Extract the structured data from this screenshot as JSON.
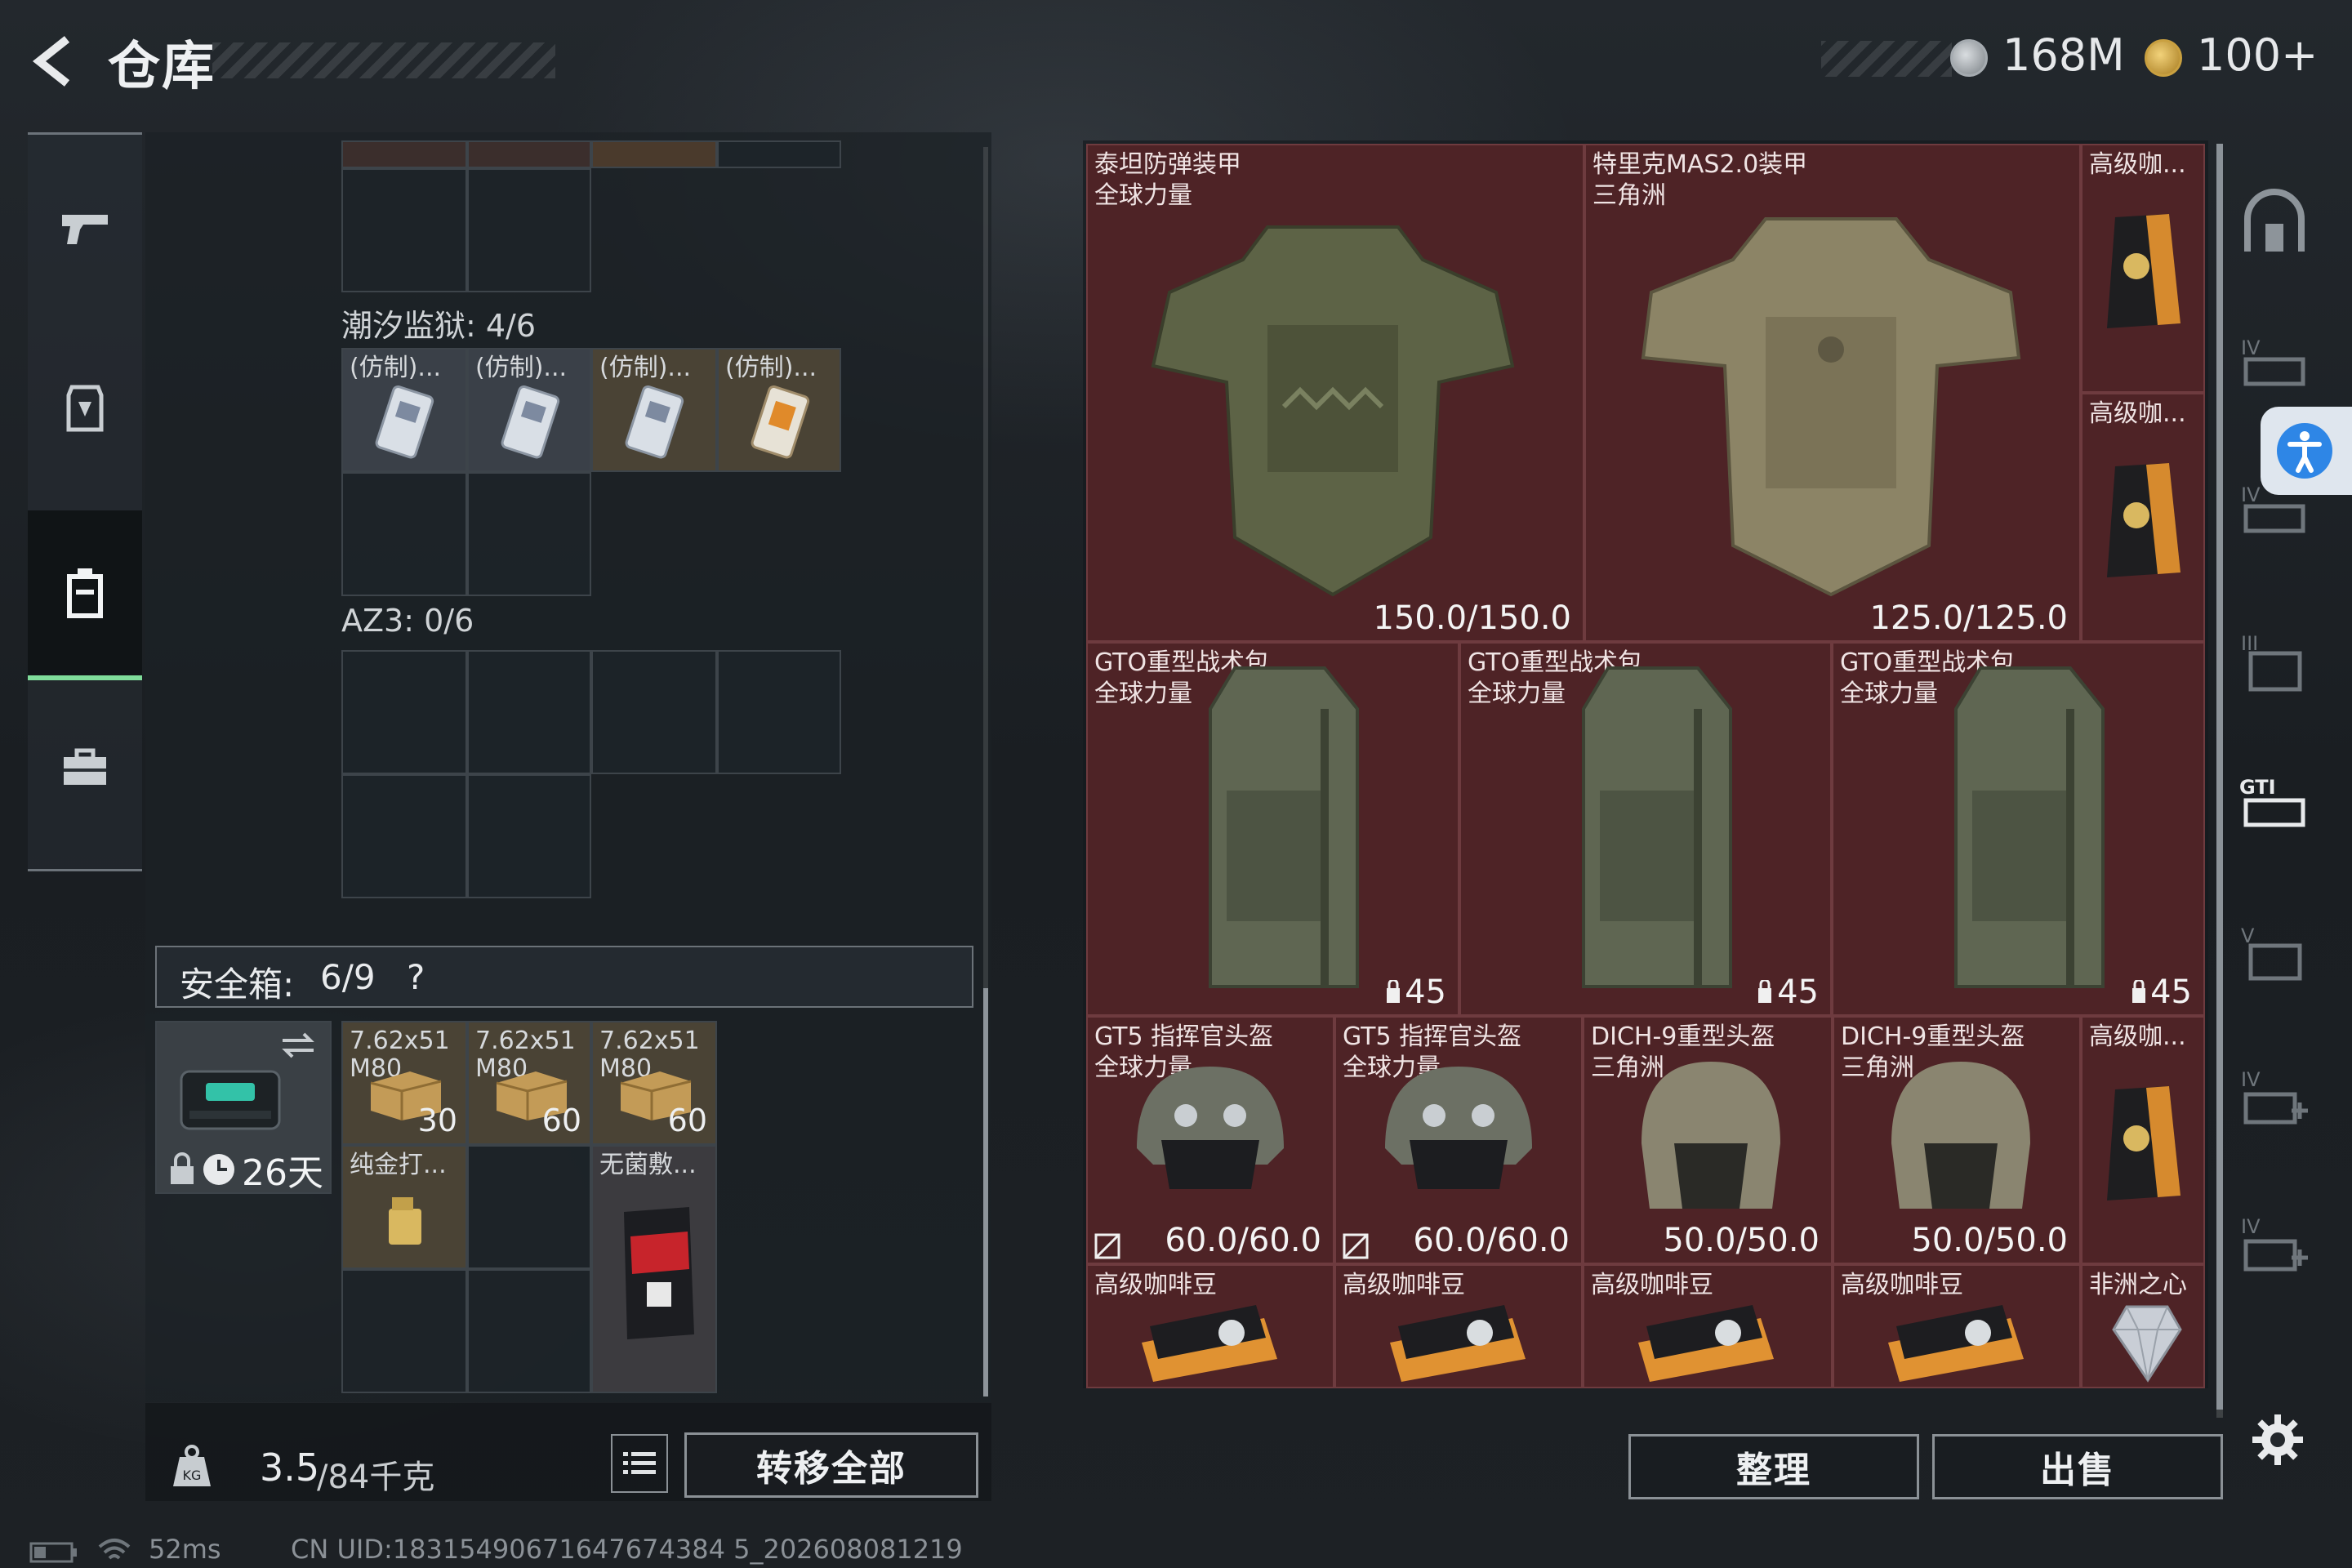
{
  "header": {
    "title": "仓库",
    "back_icon": "back-arrow-icon"
  },
  "currency": {
    "silver": {
      "value": "168M",
      "icon": "silver-coin-icon"
    },
    "gold": {
      "value": "100+",
      "icon": "gold-coin-icon"
    }
  },
  "sidebar": {
    "items": [
      {
        "name": "weapon",
        "icon": "pistol-icon"
      },
      {
        "name": "gear",
        "icon": "armor-plate-icon"
      },
      {
        "name": "backpack",
        "icon": "backpack-icon",
        "selected": true
      },
      {
        "name": "briefcase",
        "icon": "briefcase-icon"
      }
    ]
  },
  "container": {
    "sections": [
      {
        "label": "潮汐监狱: 4/6"
      },
      {
        "label": "AZ3: 0/6"
      }
    ],
    "tide_items": [
      "(仿制)...",
      "(仿制)...",
      "(仿制)...",
      "(仿制)..."
    ]
  },
  "safe_box": {
    "label": "安全箱:",
    "count": "6/9",
    "help": "?",
    "days": "26天",
    "items": [
      {
        "name": "7.62x51\nM80",
        "count": "30"
      },
      {
        "name": "7.62x51\nM80",
        "count": "60"
      },
      {
        "name": "7.62x51\nM80",
        "count": "60"
      },
      {
        "name": "纯金打...",
        "count": ""
      },
      {
        "name": "无菌敷...",
        "count": ""
      }
    ]
  },
  "weight": {
    "current": "3.5",
    "max": "/84千克"
  },
  "buttons": {
    "transfer_all": "转移全部",
    "organize": "整理",
    "sell": "出售"
  },
  "stash": {
    "armors": [
      {
        "name": "泰坦防弹装甲",
        "sub": "全球力量",
        "durability": "150.0/150.0"
      },
      {
        "name": "特里克MAS2.0装甲",
        "sub": "三角洲",
        "durability": "125.0/125.0"
      }
    ],
    "coffee_small": [
      {
        "name": "高级咖..."
      },
      {
        "name": "高级咖..."
      },
      {
        "name": "高级咖..."
      }
    ],
    "backpacks": [
      {
        "name": "GTO重型战术包",
        "sub": "全球力量",
        "slots": "45"
      },
      {
        "name": "GTO重型战术包",
        "sub": "全球力量",
        "slots": "45"
      },
      {
        "name": "GTO重型战术包",
        "sub": "全球力量",
        "slots": "45"
      }
    ],
    "helmets": [
      {
        "name": "GT5 指挥官头盔",
        "sub": "全球力量",
        "durability": "60.0/60.0"
      },
      {
        "name": "GT5 指挥官头盔",
        "sub": "全球力量",
        "durability": "60.0/60.0"
      },
      {
        "name": "DICH-9重型头盔",
        "sub": "三角洲",
        "durability": "50.0/50.0"
      },
      {
        "name": "DICH-9重型头盔",
        "sub": "三角洲",
        "durability": "50.0/50.0"
      }
    ],
    "bottom_row": [
      {
        "name": "高级咖啡豆"
      },
      {
        "name": "高级咖啡豆"
      },
      {
        "name": "高级咖啡豆"
      },
      {
        "name": "高级咖啡豆"
      },
      {
        "name": "非洲之心"
      }
    ]
  },
  "status": {
    "ping": "52ms",
    "uid": "CN UID:18315490671647674384 5_202608081219"
  },
  "colors": {
    "stash_bg": "#4e2326",
    "accent_green": "#7fdc9a"
  }
}
